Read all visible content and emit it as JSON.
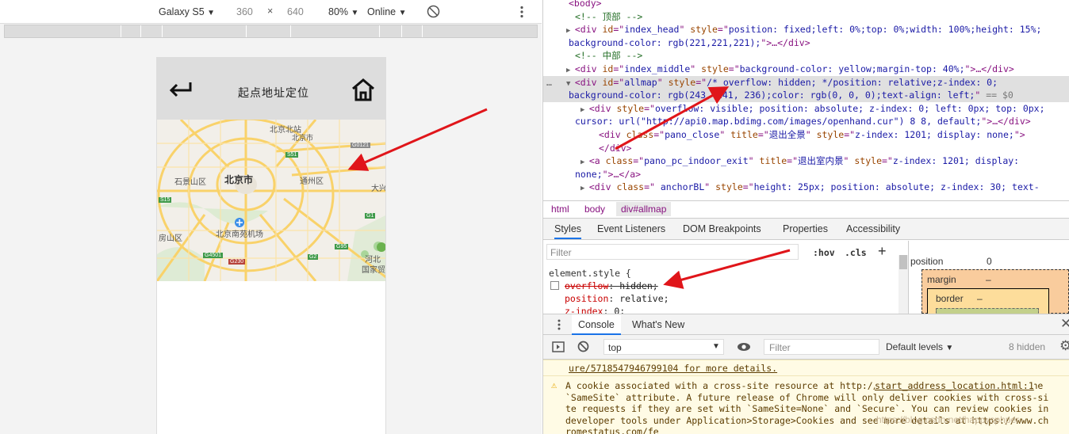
{
  "emulator": {
    "device": "Galaxy S5",
    "width": "360",
    "times": "×",
    "height": "640",
    "zoom": "80%",
    "network": "Online"
  },
  "app": {
    "title": "起点地址定位",
    "map_labels": {
      "beijing_city": "北京市",
      "shijingshan": "石景山区",
      "fangshan": "房山区",
      "tongzhou": "通州区",
      "daxing": "大兴",
      "beijing_north": "北京北站",
      "beijing_south_airport": "北京南苑机场",
      "hebei": "河北",
      "gujia": "国家贸",
      "changping_area": "北京市"
    },
    "map_road_badges": [
      "G0121",
      "S51",
      "G1",
      "S15",
      "G4501",
      "G230",
      "G2",
      "G95"
    ]
  },
  "devtools": {
    "elements": [
      {
        "indent": 0,
        "parts": [
          [
            "tag",
            "<body>"
          ]
        ]
      },
      {
        "indent": 1,
        "parts": [
          [
            "cmt",
            "<!-- 顶部 -->"
          ]
        ]
      },
      {
        "indent": 1,
        "tri": "▶",
        "parts": [
          [
            "tag",
            "<div "
          ],
          [
            "attr",
            "id"
          ],
          [
            "tag",
            "=\""
          ],
          [
            "val",
            "index_head"
          ],
          [
            "tag",
            "\" "
          ],
          [
            "attr",
            "style"
          ],
          [
            "tag",
            "=\""
          ],
          [
            "val",
            "position: fixed;left: 0%;top: 0%;width: 100%;height: 15%;"
          ]
        ]
      },
      {
        "indent": 0,
        "parts": [
          [
            "val",
            "background-color: rgb(221,221,221);"
          ],
          [
            "tag",
            "\">…</div>"
          ]
        ]
      },
      {
        "indent": 1,
        "parts": [
          [
            "cmt",
            "<!-- 中部 -->"
          ]
        ]
      },
      {
        "indent": 1,
        "tri": "▶",
        "parts": [
          [
            "tag",
            "<div "
          ],
          [
            "attr",
            "id"
          ],
          [
            "tag",
            "=\""
          ],
          [
            "val",
            "index_middle"
          ],
          [
            "tag",
            "\" "
          ],
          [
            "attr",
            "style"
          ],
          [
            "tag",
            "=\""
          ],
          [
            "val",
            "background-color: yellow;margin-top: 40%;"
          ],
          [
            "tag",
            "\">…</div>"
          ]
        ]
      },
      {
        "indent": 1,
        "tri": "▼",
        "selected": true,
        "parts": [
          [
            "tag",
            "<div "
          ],
          [
            "attr",
            "id"
          ],
          [
            "tag",
            "=\""
          ],
          [
            "val",
            "allmap"
          ],
          [
            "tag",
            "\" "
          ],
          [
            "attr",
            "style"
          ],
          [
            "tag",
            "=\""
          ],
          [
            "val",
            "/* overflow: hidden; */position: relative;z-index: 0;"
          ]
        ]
      },
      {
        "indent": 0,
        "selected": true,
        "parts": [
          [
            "val",
            "background-color: rgb(243, 241, 236);color: rgb(0, 0, 0);text-align: left;"
          ],
          [
            "tag",
            "\""
          ],
          [
            "txt",
            " == $0"
          ]
        ]
      },
      {
        "indent": 2,
        "tri": "▶",
        "parts": [
          [
            "tag",
            "<div "
          ],
          [
            "attr",
            "style"
          ],
          [
            "tag",
            "=\""
          ],
          [
            "val",
            "overflow: visible; position: absolute; z-index: 0; left: 0px; top: 0px;"
          ]
        ]
      },
      {
        "indent": 1,
        "parts": [
          [
            "val",
            "cursor: url(\"http://api0.map.bdimg.com/images/openhand.cur\") 8 8, default;"
          ],
          [
            "tag",
            "\">…</div>"
          ]
        ]
      },
      {
        "indent": 3,
        "parts": [
          [
            "tag",
            "<div "
          ],
          [
            "attr",
            "class"
          ],
          [
            "tag",
            "=\""
          ],
          [
            "val",
            "pano_close"
          ],
          [
            "tag",
            "\" "
          ],
          [
            "attr",
            "title"
          ],
          [
            "tag",
            "=\""
          ],
          [
            "val",
            "退出全景"
          ],
          [
            "tag",
            "\" "
          ],
          [
            "attr",
            "style"
          ],
          [
            "tag",
            "=\""
          ],
          [
            "val",
            "z-index: 1201; display: none;"
          ],
          [
            "tag",
            "\">"
          ]
        ]
      },
      {
        "indent": 3,
        "parts": [
          [
            "tag",
            "</div>"
          ]
        ]
      },
      {
        "indent": 2,
        "tri": "▶",
        "parts": [
          [
            "tag",
            "<a "
          ],
          [
            "attr",
            "class"
          ],
          [
            "tag",
            "=\""
          ],
          [
            "val",
            "pano_pc_indoor_exit"
          ],
          [
            "tag",
            "\" "
          ],
          [
            "attr",
            "title"
          ],
          [
            "tag",
            "=\""
          ],
          [
            "val",
            "退出室内景"
          ],
          [
            "tag",
            "\" "
          ],
          [
            "attr",
            "style"
          ],
          [
            "tag",
            "=\""
          ],
          [
            "val",
            "z-index: 1201; display:"
          ]
        ]
      },
      {
        "indent": 1,
        "parts": [
          [
            "val",
            "none;"
          ],
          [
            "tag",
            "\">…</a>"
          ]
        ]
      },
      {
        "indent": 2,
        "tri": "▶",
        "parts": [
          [
            "tag",
            "<div "
          ],
          [
            "attr",
            "class"
          ],
          [
            "tag",
            "=\""
          ],
          [
            "val",
            " anchorBL"
          ],
          [
            "tag",
            "\" "
          ],
          [
            "attr",
            "style"
          ],
          [
            "tag",
            "=\""
          ],
          [
            "val",
            "height: 25px; position: absolute; z-index: 30; text-"
          ]
        ]
      }
    ],
    "breadcrumbs": [
      "html",
      "body",
      "div#allmap"
    ],
    "tabs": [
      "Styles",
      "Event Listeners",
      "DOM Breakpoints",
      "Properties",
      "Accessibility"
    ],
    "styles": {
      "filter_placeholder": "Filter",
      "hov": ":hov",
      "cls": ".cls",
      "plus": "+",
      "selector": "element.style {",
      "rules": [
        {
          "prop": "overflow",
          "value": "hidden;",
          "disabled": true
        },
        {
          "prop": "position",
          "value": "relative;",
          "disabled": false
        },
        {
          "prop": "z-index",
          "value": "0;",
          "disabled": false
        }
      ]
    },
    "box_model": {
      "position_label": "position",
      "position_value": "0",
      "margin_label": "margin",
      "margin_value": "–",
      "border_label": "border",
      "border_value": "–"
    },
    "console": {
      "tabs": [
        "Console",
        "What's New"
      ],
      "context": "top",
      "filter_placeholder": "Filter",
      "levels": "Default levels",
      "hidden": "8 hidden",
      "messages": [
        "ure/5718547946799104 for more details.",
        "A cookie associated with a cross-site resource at http://baidu.com/ was set without the `SameSite` attribute. A future release of Chrome will only deliver cookies with cross-site requests if they are set with `SameSite=None` and `Secure`. You can review cookies in developer tools under Application>Storage>Cookies and see more details at https://www.chromestatus.com/fe"
      ],
      "message_link": "start_address_location.html:1",
      "watermark": "https://blog.csdn.net/happysphper"
    }
  }
}
